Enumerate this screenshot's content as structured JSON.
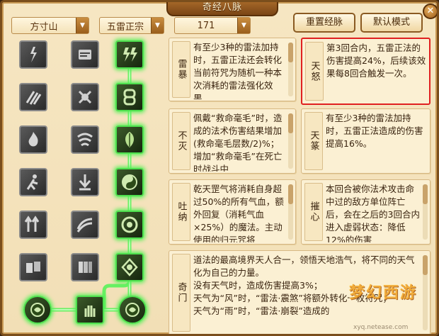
{
  "window": {
    "title": "奇经八脉",
    "close_label": "✕"
  },
  "filters": {
    "school": "方寸山",
    "branch": "五雷正宗",
    "level": "171"
  },
  "buttons": {
    "reset": "重置经脉",
    "default": "默认模式"
  },
  "cards": [
    {
      "name": "雷暴",
      "desc": "有至少3种的雷法加持时，五雷正法还会转化当前符咒为随机一种本次消耗的雷法强化效果。"
    },
    {
      "name": "天怒",
      "desc": "第3回合内，五雷正法的伤害提高24%，后续该效果每8回合触发一次。"
    },
    {
      "name": "不灭",
      "desc": "佩戴“救命毫毛”时，造成的法术伤害结果增加(救命毫毛层数/2)%；增加“救命毫毛”在死亡时战斗中"
    },
    {
      "name": "天篆",
      "desc": "有至少3种的雷法加持时，五雷正法造成的伤害提高16%。"
    },
    {
      "name": "吐纳",
      "desc": "乾天罡气将消耗自身超过50%的所有气血，额外回复（消耗气血×25%）的魔法。主动使用的归元咒将"
    },
    {
      "name": "摧心",
      "desc": "本回合被你法术攻击命中过的敌方单位阵亡后，会在之后的3回合内进入虚弱状态：降低12%的伤害"
    },
    {
      "name": "奇门",
      "desc": "道法的最高境界天人合一，领悟天地浩气，将不同的天气化为自己的力量。\n没有天气时，造成伤害提高3%；\n天气为“风”时，“雷法·震煞”将额外转化一枚符咒；\n天气为“雨”时，“雷法·崩裂”造成的"
    }
  ],
  "watermark": {
    "logo": "梦幻西游",
    "url": "xyq.netease.com"
  }
}
